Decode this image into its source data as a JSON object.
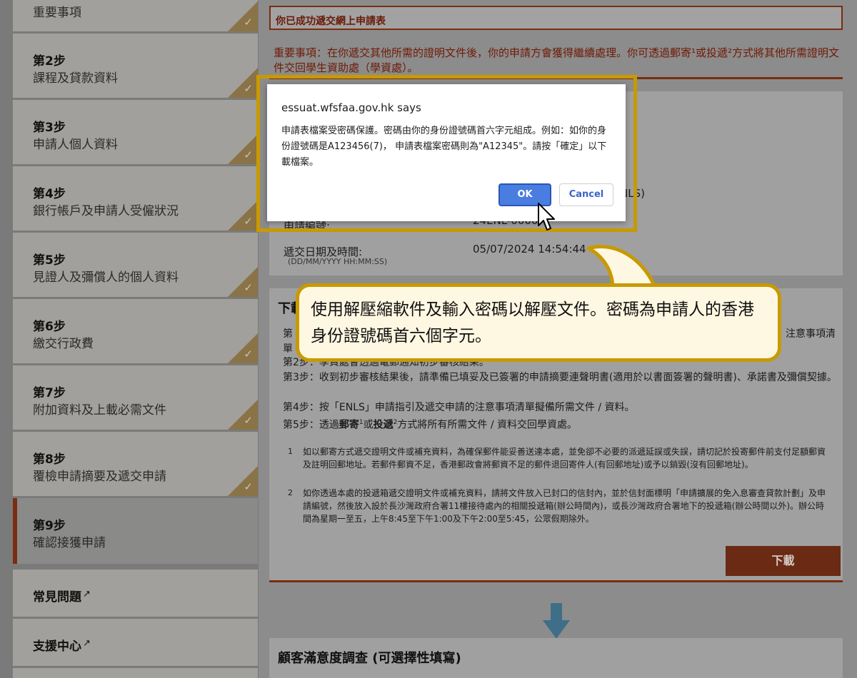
{
  "sidebar": {
    "steps": [
      {
        "num": "",
        "label": "重要事項"
      },
      {
        "num": "第2步",
        "label": "課程及貸款資料"
      },
      {
        "num": "第3步",
        "label": "申請人個人資料"
      },
      {
        "num": "第4步",
        "label": "銀行帳戶及申請人受僱狀況"
      },
      {
        "num": "第5步",
        "label": "見證人及彌償人的個人資料"
      },
      {
        "num": "第6步",
        "label": "繳交行政費"
      },
      {
        "num": "第7步",
        "label": "附加資料及上載必需文件"
      },
      {
        "num": "第8步",
        "label": "覆檢申請摘要及遞交申請"
      },
      {
        "num": "第9步",
        "label": "確認接獲申請"
      }
    ],
    "links": [
      {
        "label": "常見問題",
        "icon": "external-link-icon"
      },
      {
        "label": "支援中心",
        "icon": "external-link-icon"
      }
    ],
    "check_glyph": "✓"
  },
  "main": {
    "success_title": "你已成功遞交網上申請表",
    "important_notice": "重要事項：在你遞交其他所需的證明文件後，你的申請方會獲得繼續處理。你可透過郵寄¹或投遞²方式將其他所需證明文件交回學生資助處（學資處）。",
    "partial_ref_value": "NLS)",
    "partial_app_label": "申請編號:",
    "partial_app_value": "24ENL-0000",
    "submit_label": "遞交日期及時間:",
    "submit_format": "(DD/MM/YYYY HH:MM:SS)",
    "submit_value": "05/07/2024 14:54:44",
    "download_title_partial": "下載",
    "steps_partial_1": "第",
    "steps_partial_1b": "單",
    "steps_partial_right": "注意事項清",
    "step2_partial": "第2步：學資處會透過電郵通知初步審核結果。",
    "step3": "第3步：收到初步審核結果後，請準備已填妥及已簽署的申請摘要連聲明書(適用於以書面簽署的聲明書)、承諾書及彌償契據。",
    "step4": "第4步：按「ENLS」申請指引及遞交申請的注意事項清單擬備所需文件 / 資料。",
    "step5_a": "第5步：透過",
    "step5_mail": "郵寄",
    "step5_sup1": "1",
    "step5_or": "或",
    "step5_deliver": "投遞",
    "step5_sup2": "2",
    "step5_b": "方式將所有所需文件 / 資料交回學資處。",
    "footnote1_num": "1",
    "footnote1": "如以郵寄方式遞交證明文件或補充資料，為確保郵件能妥善送達本處，並免卻不必要的派遞延誤或失誤，請切記於投寄郵件前支付足額郵資及註明回郵地址。若郵件郵資不足，香港郵政會將郵資不足的郵件退回寄件人(有回郵地址)或予以銷毀(沒有回郵地址)。",
    "footnote2_num": "2",
    "footnote2": "如你透過本處的投遞箱遞交證明文件或補充資料，請將文件放入已封口的信封內，並於信封面標明「申請擴展的免入息審查貸款計劃」及申請編號，然後放入設於長沙灣政府合署11樓接待處內的相關投遞箱(辦公時間內)，或長沙灣政府合署地下的投遞箱(辦公時間以外)。辦公時間為星期一至五，上午8:45至下午1:00及下午2:00至5:45，公眾假期除外。",
    "download_button": "下載",
    "survey_title": "顧客滿意度調查 (可選擇性填寫)"
  },
  "dialog": {
    "title": "essuat.wfsfaa.gov.hk says",
    "message": "申請表檔案受密碼保護。密碼由你的身份證號碼首六字元組成。例如：如你的身份證號碼是A123456(7)， 申請表檔案密碼則為\"A12345\"。請按「確定」以下載檔案。",
    "ok_label": "OK",
    "cancel_label": "Cancel"
  },
  "callout": {
    "text": "使用解壓縮軟件及輸入密碼以解壓文件。密碼為申請人的香港身份證號碼首六個字元。"
  },
  "colors": {
    "accent_brown": "#7a2d10",
    "highlight_gold": "#c79a00",
    "ok_blue": "#4a7de0"
  }
}
